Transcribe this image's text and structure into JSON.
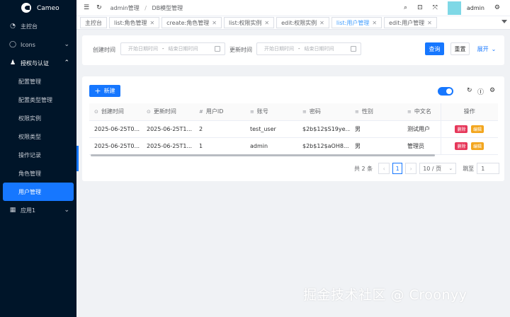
{
  "app": {
    "name": "Cameo"
  },
  "sidebar": {
    "items": [
      {
        "label": "主控台",
        "icon": "dashboard-icon"
      },
      {
        "label": "Icons",
        "icon": "circle-icon"
      },
      {
        "label": "授权与认证",
        "icon": "user-icon"
      }
    ],
    "sub_items": [
      "配置管理",
      "配置类型管理",
      "权限实例",
      "权限类型",
      "操作记录",
      "角色管理",
      "用户管理"
    ],
    "last_item": {
      "label": "应用1",
      "icon": "grid-icon"
    }
  },
  "header": {
    "breadcrumb": [
      "admin管理",
      "DB模型管理"
    ],
    "username": "admin"
  },
  "tabs": [
    {
      "label": "主控台",
      "closable": false
    },
    {
      "label": "list:角色管理",
      "closable": true
    },
    {
      "label": "create:角色管理",
      "closable": true
    },
    {
      "label": "list:权限实例",
      "closable": true
    },
    {
      "label": "edit:权限实例",
      "closable": true
    },
    {
      "label": "list:用户管理",
      "closable": true,
      "active": true
    },
    {
      "label": "edit:用户管理",
      "closable": true
    }
  ],
  "search": {
    "created_label": "创建时间",
    "updated_label": "更新时间",
    "start_placeholder": "开始日期时间",
    "end_placeholder": "结束日期时间",
    "dash": "-",
    "query_button": "查询",
    "reset_button": "重置",
    "expand_button": "展开"
  },
  "table": {
    "add_button": "新建",
    "columns": [
      {
        "label": "创建时间",
        "icon": "⊙"
      },
      {
        "label": "更新时间",
        "icon": "⊙"
      },
      {
        "label": "用户ID",
        "icon": "#"
      },
      {
        "label": "账号",
        "icon": "≡"
      },
      {
        "label": "密码",
        "icon": "≡"
      },
      {
        "label": "性别",
        "icon": "≡"
      },
      {
        "label": "中文名",
        "icon": "≡"
      },
      {
        "label": "操作",
        "icon": ""
      }
    ],
    "rows": [
      [
        "2025-06-25T0...",
        "2025-06-25T1...",
        "2",
        "test_user",
        "$2b$12$S19ye...",
        "男",
        "测试用户"
      ],
      [
        "2025-06-25T0...",
        "2025-06-25T1...",
        "1",
        "admin",
        "$2b$12$aOH8...",
        "男",
        "管理员"
      ]
    ],
    "delete_label": "删除",
    "edit_label": "编辑"
  },
  "pagination": {
    "total_text": "共 2 条",
    "current_page": "1",
    "page_size": "10 / 页",
    "jump_label": "跳至",
    "jump_value": "1"
  },
  "watermark": "掘金技术社区 @ Croonyy",
  "colors": {
    "sidebar_bg": "#001529",
    "primary": "#1677ff",
    "delete_tag": "#e6375a",
    "edit_tag": "#f3a61e"
  }
}
